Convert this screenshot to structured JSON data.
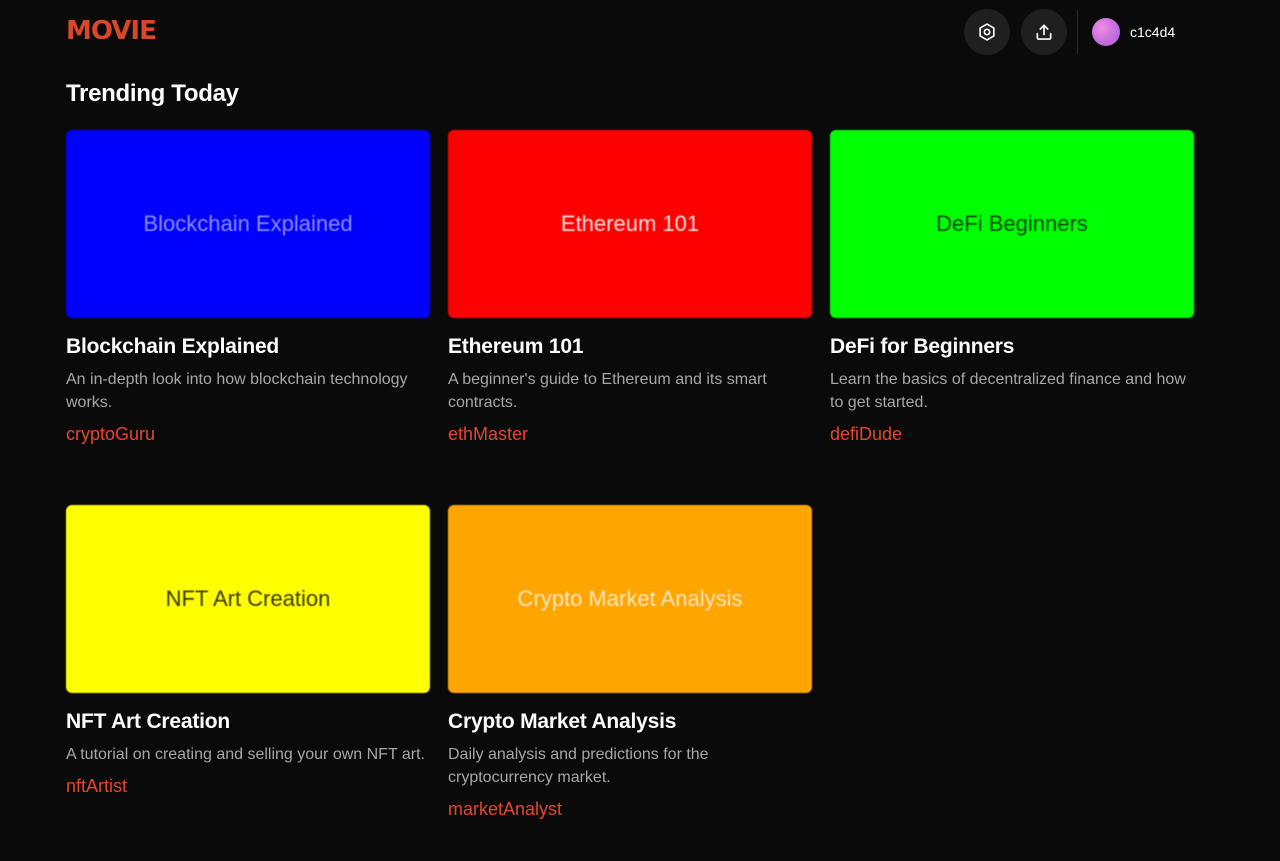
{
  "header": {
    "logo_text": "MOVIE",
    "settings_icon": "settings-icon",
    "upload_icon": "upload-icon",
    "username": "c1c4d4"
  },
  "section": {
    "title": "Trending Today"
  },
  "cards": [
    {
      "thumb_text": "Blockchain Explained",
      "thumb_color": "#0000ff",
      "thumb_text_color": "#8c8cff",
      "title": "Blockchain Explained",
      "description": "An in-depth look into how blockchain technology works.",
      "author": "cryptoGuru"
    },
    {
      "thumb_text": "Ethereum 101",
      "thumb_color": "#ff0000",
      "thumb_text_color": "#ffe0e0",
      "title": "Ethereum 101",
      "description": "A beginner's guide to Ethereum and its smart contracts.",
      "author": "ethMaster"
    },
    {
      "thumb_text": "DeFi Beginners",
      "thumb_color": "#00ff00",
      "thumb_text_color": "#0a4a0a",
      "title": "DeFi for Beginners",
      "description": "Learn the basics of decentralized finance and how to get started.",
      "author": "defiDude"
    },
    {
      "thumb_text": "NFT Art Creation",
      "thumb_color": "#ffff00",
      "thumb_text_color": "#3a3a00",
      "title": "NFT Art Creation",
      "description": "A tutorial on creating and selling your own NFT art.",
      "author": "nftArtist"
    },
    {
      "thumb_text": "Crypto Market Analysis",
      "thumb_color": "#ffa500",
      "thumb_text_color": "#ffe6c0",
      "title": "Crypto Market Analysis",
      "description": "Daily analysis and predictions for the cryptocurrency market.",
      "author": "marketAnalyst"
    }
  ]
}
